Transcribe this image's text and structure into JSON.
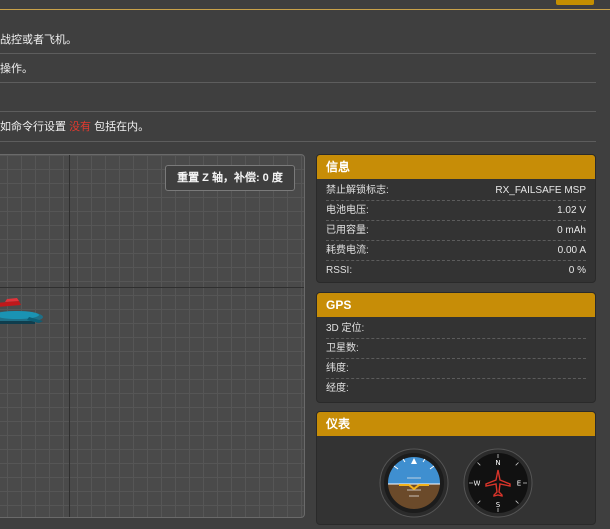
{
  "notes": [
    "战控或者飞机。",
    "操作。",
    "",
    {
      "pre": "如命令行设置 ",
      "warn": "没有",
      "post": " 包括在内。"
    }
  ],
  "viewport": {
    "reset_label": "重置 Z 轴，补偿: 0 度"
  },
  "info": {
    "title": "信息",
    "rows": [
      {
        "label": "禁止解锁标志:",
        "value": "RX_FAILSAFE MSP"
      },
      {
        "label": "电池电压:",
        "value": "1.02 V"
      },
      {
        "label": "已用容量:",
        "value": "0 mAh"
      },
      {
        "label": "耗费电流:",
        "value": "0.00 A"
      },
      {
        "label": "RSSI:",
        "value": "0 %"
      }
    ]
  },
  "gps": {
    "title": "GPS",
    "rows": [
      {
        "label": "3D 定位:",
        "value": ""
      },
      {
        "label": "卫星数:",
        "value": ""
      },
      {
        "label": "纬度:",
        "value": ""
      },
      {
        "label": "经度:",
        "value": ""
      }
    ]
  },
  "instruments": {
    "title": "仪表",
    "heading_labels": [
      "N",
      "E",
      "S",
      "W"
    ]
  },
  "colors": {
    "accent": "#c78d07",
    "warning": "#e03a2f"
  }
}
